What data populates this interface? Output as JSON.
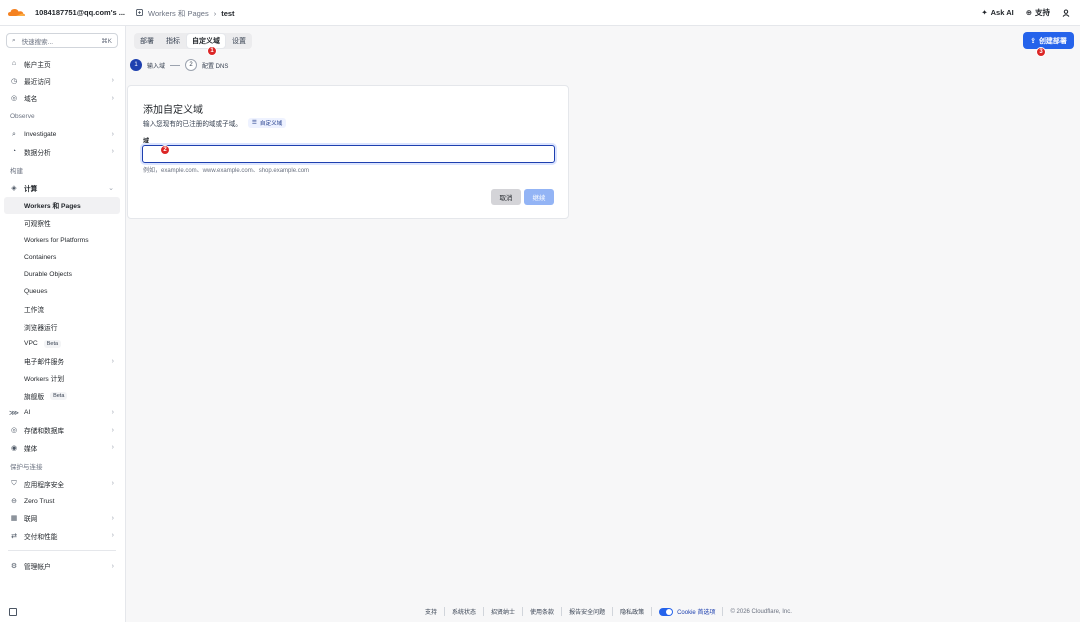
{
  "colors": {
    "accent": "#2563eb",
    "marker": "#dc2626",
    "logo": "#f48120",
    "step_active": "#1e40af"
  },
  "topbar": {
    "account": "1084187751@qq.com's ...",
    "breadcrumb_parent": "Workers 和 Pages",
    "breadcrumb_current": "test",
    "ask_ai": "Ask AI",
    "support": "支持",
    "icons": {
      "breadcrumb": "workers-icon",
      "ask_ai": "sparkle-icon",
      "support": "help-icon",
      "user": "user-icon"
    }
  },
  "sidebar": {
    "search_placeholder": "快速搜索...",
    "search_shortcut": "⌘K",
    "top_items": [
      {
        "label": "帐户主页",
        "icon": "home-icon"
      },
      {
        "label": "最近访问",
        "icon": "clock-icon"
      },
      {
        "label": "域名",
        "icon": "globe-icon"
      }
    ],
    "section_observe": "Observe",
    "observe_items": [
      {
        "label": "Investigate",
        "icon": "search-icon"
      },
      {
        "label": "数据分析",
        "icon": "chart-icon"
      }
    ],
    "section_build": "构建",
    "compute_label": "计算",
    "compute_sub": [
      "Workers 和 Pages",
      "可观察性",
      "Workers for Platforms",
      "Containers",
      "Durable Objects",
      "Queues",
      "工作流",
      "浏览器运行",
      "VPC",
      "电子邮件服务",
      "Workers 计划",
      "旗舰版"
    ],
    "beta": "Beta",
    "build_items": [
      {
        "label": "AI",
        "icon": "ai-icon"
      },
      {
        "label": "存储和数据库",
        "icon": "database-icon"
      },
      {
        "label": "媒体",
        "icon": "media-icon"
      }
    ],
    "section_protect": "保护与连接",
    "protect_items": [
      {
        "label": "应用程序安全",
        "icon": "shield-icon"
      },
      {
        "label": "Zero Trust",
        "icon": "zero-trust-icon"
      },
      {
        "label": "联网",
        "icon": "network-icon"
      },
      {
        "label": "交付和性能",
        "icon": "delivery-icon"
      }
    ],
    "manage_account": "管理帐户"
  },
  "tabs": [
    {
      "label": "部署"
    },
    {
      "label": "指标"
    },
    {
      "label": "自定义域"
    },
    {
      "label": "设置"
    }
  ],
  "create_button": "创建部署",
  "markers": [
    "1",
    "2",
    "3"
  ],
  "steps": [
    {
      "num": "1",
      "label": "输入域"
    },
    {
      "num": "2",
      "label": "配置 DNS"
    }
  ],
  "card": {
    "title": "添加自定义域",
    "description": "输入您现有的已注册的域或子域。",
    "doc_chip": "自定义域",
    "field_label": "域",
    "field_value": "",
    "field_help": "例如，example.com、www.example.com、shop.example.com",
    "cancel": "取消",
    "continue": "继续"
  },
  "footer": {
    "links": [
      "支持",
      "系统状态",
      "招贤纳士",
      "使用条款",
      "报告安全问题",
      "隐私政策"
    ],
    "cookie": "Cookie 首选项",
    "copyright": "© 2026 Cloudflare, Inc."
  }
}
